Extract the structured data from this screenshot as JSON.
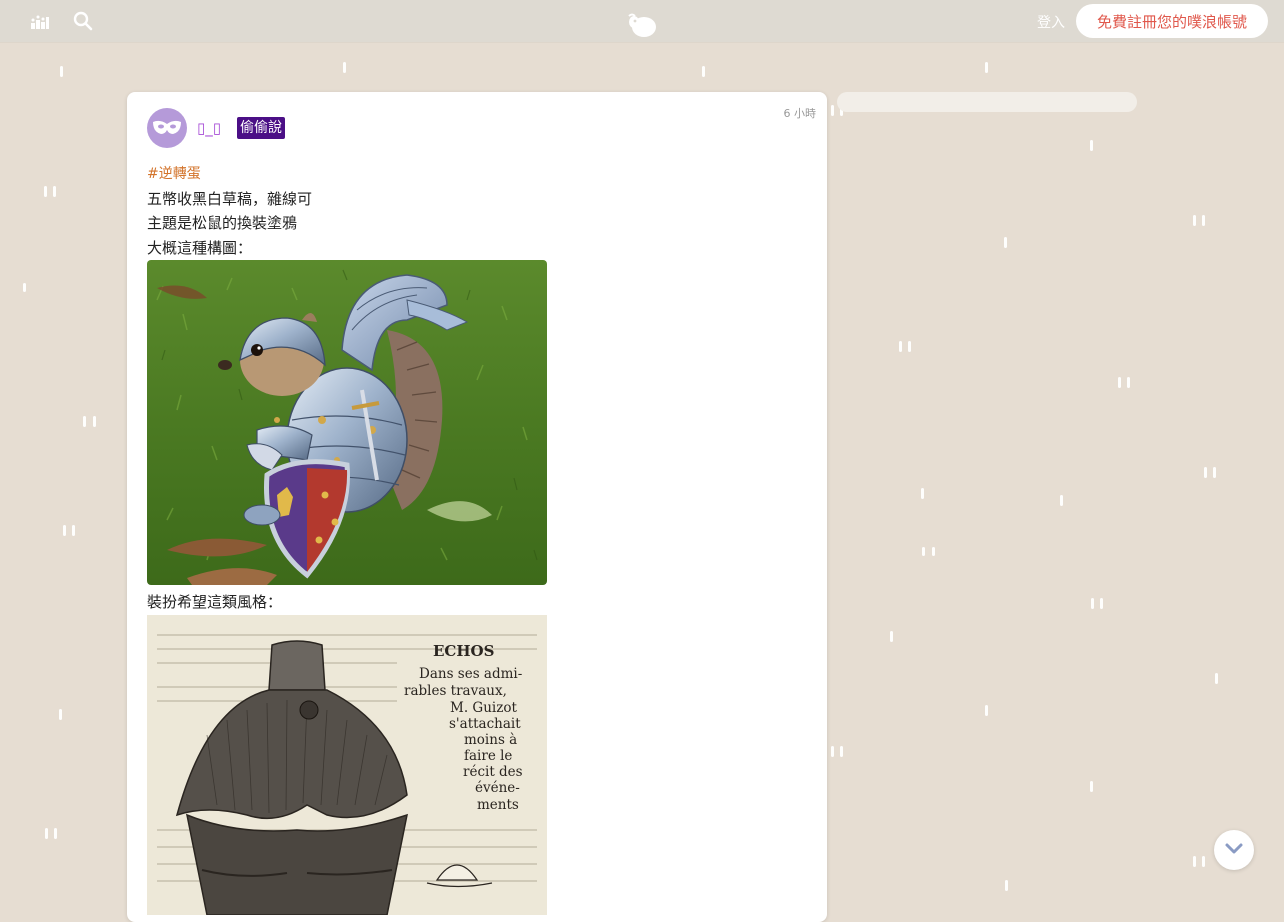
{
  "topbar": {
    "stats_icon": "bar-chart-icon",
    "search_icon": "search-icon",
    "logo_icon": "plurk-logo-icon",
    "login_label": "登入",
    "register_label": "免費註冊您的噗浪帳號",
    "register_color": "#e0584c"
  },
  "post": {
    "avatar_icon": "mask-icon",
    "username": "▯_▯",
    "badge": "偷偷說",
    "time": "6 小時",
    "hashtag": "#逆轉蛋",
    "lines": [
      "五幣收黑白草稿，雜線可",
      "主題是松鼠的換裝塗鴉",
      "大概這種構圖："
    ],
    "line_after_image": "裝扮希望這類風格：",
    "engraving_text": [
      "ECHOS",
      "Dans ses admi-",
      "rables travaux,",
      "M. Guizot",
      "s'attachait",
      "moins à",
      "faire le",
      "récit des",
      "événe-",
      "ments"
    ]
  },
  "colors": {
    "background": "#e6ddd2",
    "topbar": "#dedad2",
    "username": "#a64bd6",
    "badge": "#4b0f86",
    "hashtag": "#d3742c"
  },
  "scroll_icon": "chevron-down-icon"
}
